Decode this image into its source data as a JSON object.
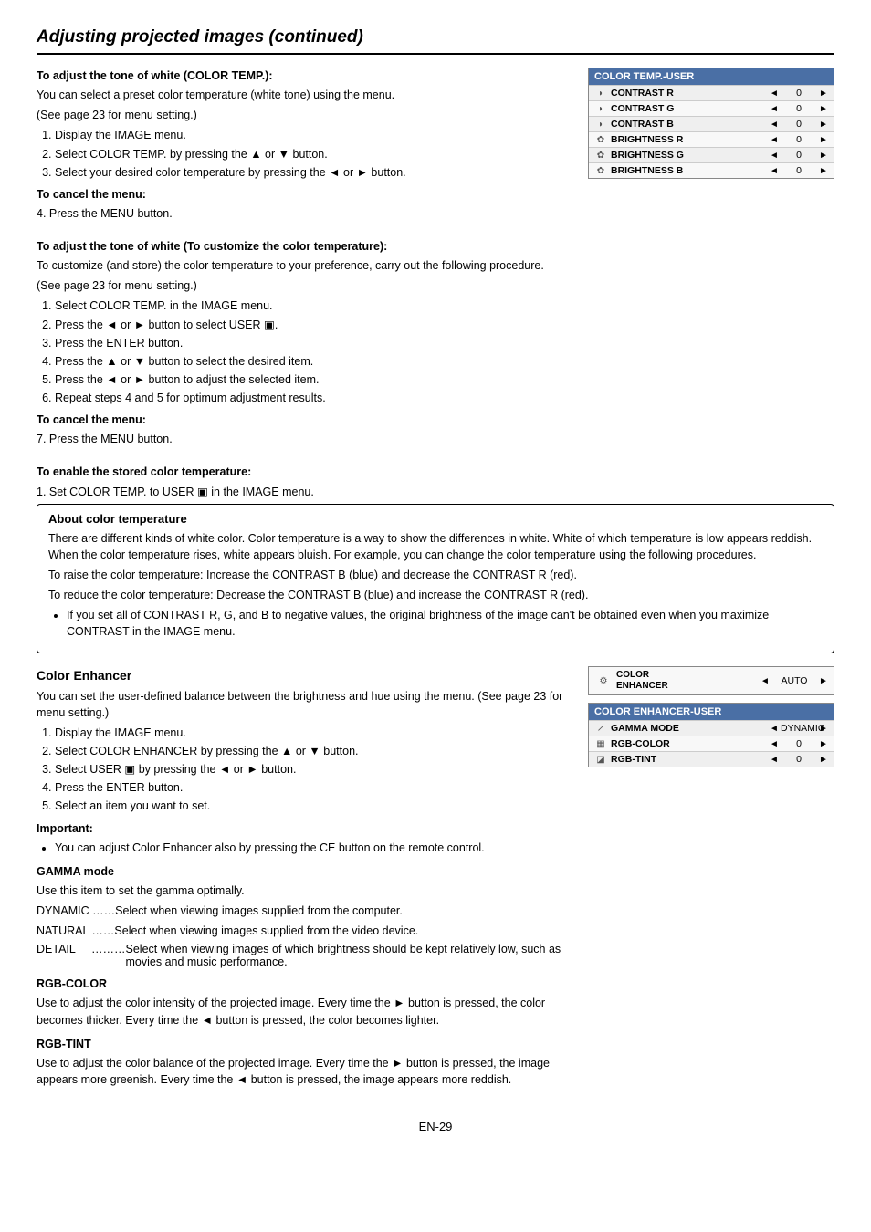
{
  "page": {
    "title": "Adjusting projected images  (continued)",
    "page_number": "EN-29"
  },
  "section_color_temp": {
    "heading": "To adjust the tone of white (COLOR TEMP.):",
    "intro": "You can select a preset color temperature (white tone) using the menu.",
    "see_page": "(See page 23 for menu setting.)",
    "steps": [
      "Display the IMAGE menu.",
      "Select COLOR TEMP. by pressing the ▲ or ▼ button.",
      "Select your desired color temperature by pressing the ◄ or ► button."
    ],
    "cancel_heading": "To cancel the menu:",
    "cancel_step": "4.  Press the MENU button.",
    "customize_heading": "To adjust the tone of white (To customize the color temperature):",
    "customize_intro": "To customize (and store) the color temperature to your preference, carry out the following procedure.",
    "customize_see_page": "(See page 23 for menu setting.)",
    "customize_steps": [
      "Select COLOR TEMP. in the IMAGE menu.",
      "Press the ◄ or ► button to select USER ▣.",
      "Press the ENTER button.",
      "Press the ▲ or ▼ button to select the desired item.",
      "Press the ◄ or ► button to adjust the selected item.",
      "Repeat steps 4 and 5 for optimum adjustment results."
    ],
    "cancel2_heading": "To cancel the menu:",
    "cancel2_step": "7.  Press the MENU button.",
    "enable_heading": "To enable the stored color temperature:",
    "enable_step": "1.  Set COLOR TEMP. to USER ▣ in the IMAGE menu."
  },
  "color_temp_user_table": {
    "header": "COLOR TEMP.-USER",
    "rows": [
      {
        "icon": "◗",
        "label": "CONTRAST R",
        "value": "0"
      },
      {
        "icon": "◗",
        "label": "CONTRAST G",
        "value": "0"
      },
      {
        "icon": "◗",
        "label": "CONTRAST B",
        "value": "0"
      },
      {
        "icon": "✿",
        "label": "BRIGHTNESS R",
        "value": "0"
      },
      {
        "icon": "✿",
        "label": "BRIGHTNESS G",
        "value": "0"
      },
      {
        "icon": "✿",
        "label": "BRIGHTNESS B",
        "value": "0"
      }
    ]
  },
  "about_color_temp": {
    "title": "About color temperature",
    "para1": "There are different kinds of white color. Color temperature is a way to show the differences in white. White of which temperature is low appears reddish. When the color temperature rises, white appears bluish. For example, you can change the color temperature using the following procedures.",
    "para2": "To raise the color temperature: Increase the CONTRAST B (blue) and decrease the CONTRAST R (red).",
    "para3": "To reduce the color temperature: Decrease the CONTRAST B (blue) and increase the CONTRAST R (red).",
    "bullet": "If you set all of CONTRAST R, G, and B to negative values, the original brightness of the image can't be obtained even when you maximize CONTRAST in the IMAGE menu."
  },
  "color_enhancer": {
    "title": "Color Enhancer",
    "intro": "You can set the user-defined balance between the brightness and hue using the menu. (See page 23 for menu setting.)",
    "steps": [
      "Display the IMAGE menu.",
      "Select COLOR ENHANCER by pressing the ▲ or ▼ button.",
      "Select USER ▣ by pressing the ◄ or ► button.",
      "Press the ENTER button.",
      "Select an item you want to set."
    ],
    "important_label": "Important:",
    "important_bullet": "You can adjust Color Enhancer also by pressing the CE button on the remote control.",
    "gamma_mode_label": "GAMMA mode",
    "gamma_mode_desc": "Use this item to set the gamma optimally.",
    "gamma_dynamic": "DYNAMIC  ……Select when viewing images supplied from the computer.",
    "gamma_natural": "NATURAL   ……Select when viewing images supplied from the video device.",
    "gamma_detail_label": "DETAIL",
    "gamma_detail_dots": "………",
    "gamma_detail_text": "Select when viewing images of which brightness should be kept relatively low, such as movies and music performance.",
    "rgb_color_label": "RGB-COLOR",
    "rgb_color_desc": "Use to adjust the color intensity of the projected image. Every time the ► button is pressed, the color becomes thicker. Every time the ◄ button is pressed, the color becomes lighter.",
    "rgb_tint_label": "RGB-TINT",
    "rgb_tint_desc": "Use to adjust the color balance of the projected image. Every time the ► button is pressed, the image appears more greenish. Every time the ◄ button is pressed, the image appears more reddish."
  },
  "color_enhancer_single": {
    "icon": "🎨",
    "label_line1": "COLOR",
    "label_line2": "ENHANCER",
    "value": "AUTO"
  },
  "color_enhancer_user_table": {
    "header": "COLOR ENHANCER-USER",
    "rows": [
      {
        "icon": "↗",
        "label": "GAMMA MODE",
        "value": "DYNAMIC"
      },
      {
        "icon": "▦",
        "label": "RGB-COLOR",
        "value": "0"
      },
      {
        "icon": "◪",
        "label": "RGB-TINT",
        "value": "0"
      }
    ]
  }
}
